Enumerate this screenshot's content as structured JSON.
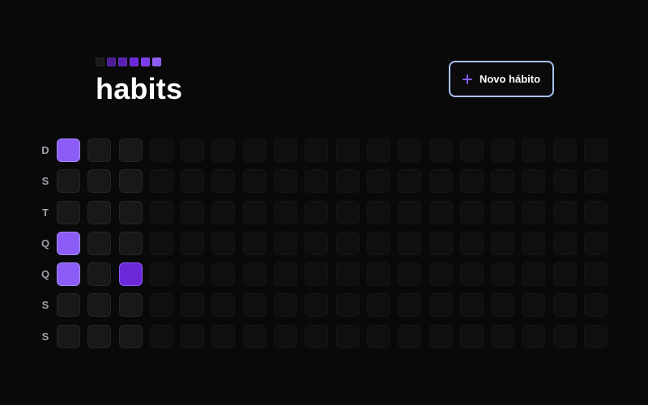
{
  "header": {
    "title": "habits",
    "logo_squares": [
      "#18181b",
      "#4c1d95",
      "#5b21b6",
      "#6d28d9",
      "#7c3aed",
      "#8b5cf6"
    ]
  },
  "new_habit_button": {
    "label": "Novo hábito",
    "icon": "plus-icon",
    "border_color": "#a8c4f8",
    "icon_color": "#8b5cf6"
  },
  "weekdays": [
    "D",
    "S",
    "T",
    "Q",
    "Q",
    "S",
    "S"
  ],
  "grid": {
    "weeks": 18,
    "days_in_range": 21,
    "completion_levels": [
      [
        3,
        0,
        0,
        3,
        3,
        0,
        0
      ],
      [
        0,
        0,
        0,
        0,
        0,
        0,
        0
      ],
      [
        0,
        0,
        0,
        0,
        4,
        0,
        0
      ]
    ]
  },
  "colors": {
    "background": "#09090a",
    "empty_cell": "#18181b",
    "completed_light": "#8b5cf6",
    "completed_dark": "#6d28d9"
  }
}
